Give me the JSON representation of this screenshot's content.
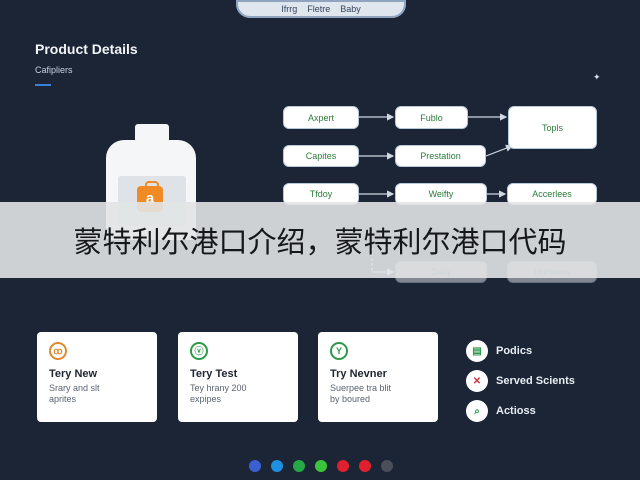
{
  "top_tabs": [
    "Ifrrg",
    "Fletre",
    "Baby"
  ],
  "page": {
    "title": "Product Details",
    "subtitle": "Cafipliers"
  },
  "flow": {
    "nodes": [
      {
        "label": "Axpert"
      },
      {
        "label": "Fublo"
      },
      {
        "label": "Topls"
      },
      {
        "label": "Capites"
      },
      {
        "label": "Prestation"
      },
      {
        "label": "Tfdoy"
      },
      {
        "label": "Weifty"
      },
      {
        "label": "Accerlees"
      },
      {
        "label": "Daily"
      },
      {
        "label": "Humvers"
      }
    ]
  },
  "banner": {
    "text": "蒙特利尔港口介绍，蒙特利尔港口代码"
  },
  "cards": [
    {
      "icon": "ꝏ",
      "title": "Tery New",
      "desc_line1": "Srary and slt",
      "desc_line2": "aprites",
      "color": "#e08a2c"
    },
    {
      "icon": "ⓥ",
      "title": "Tery Test",
      "desc_line1": "Tey hrany 200",
      "desc_line2": "expipes",
      "color": "#2e9a48"
    },
    {
      "icon": "Y",
      "title": "Try Nevner",
      "desc_line1": "Suerpee tra blit",
      "desc_line2": "by boured",
      "color": "#2e9a48"
    }
  ],
  "side_actions": [
    {
      "icon": "▤",
      "label": "Podics",
      "color": "#2e9a48"
    },
    {
      "icon": "✕",
      "label": "Served Scients",
      "color": "#d7323a"
    },
    {
      "icon": "⌕",
      "label": "Actioss",
      "color": "#2e9a48"
    }
  ],
  "pager_dots": [
    "#3a5fd0",
    "#1f8fe0",
    "#26a845",
    "#3cc43c",
    "#e0202e",
    "#e0202e",
    "#4a4f5a"
  ]
}
